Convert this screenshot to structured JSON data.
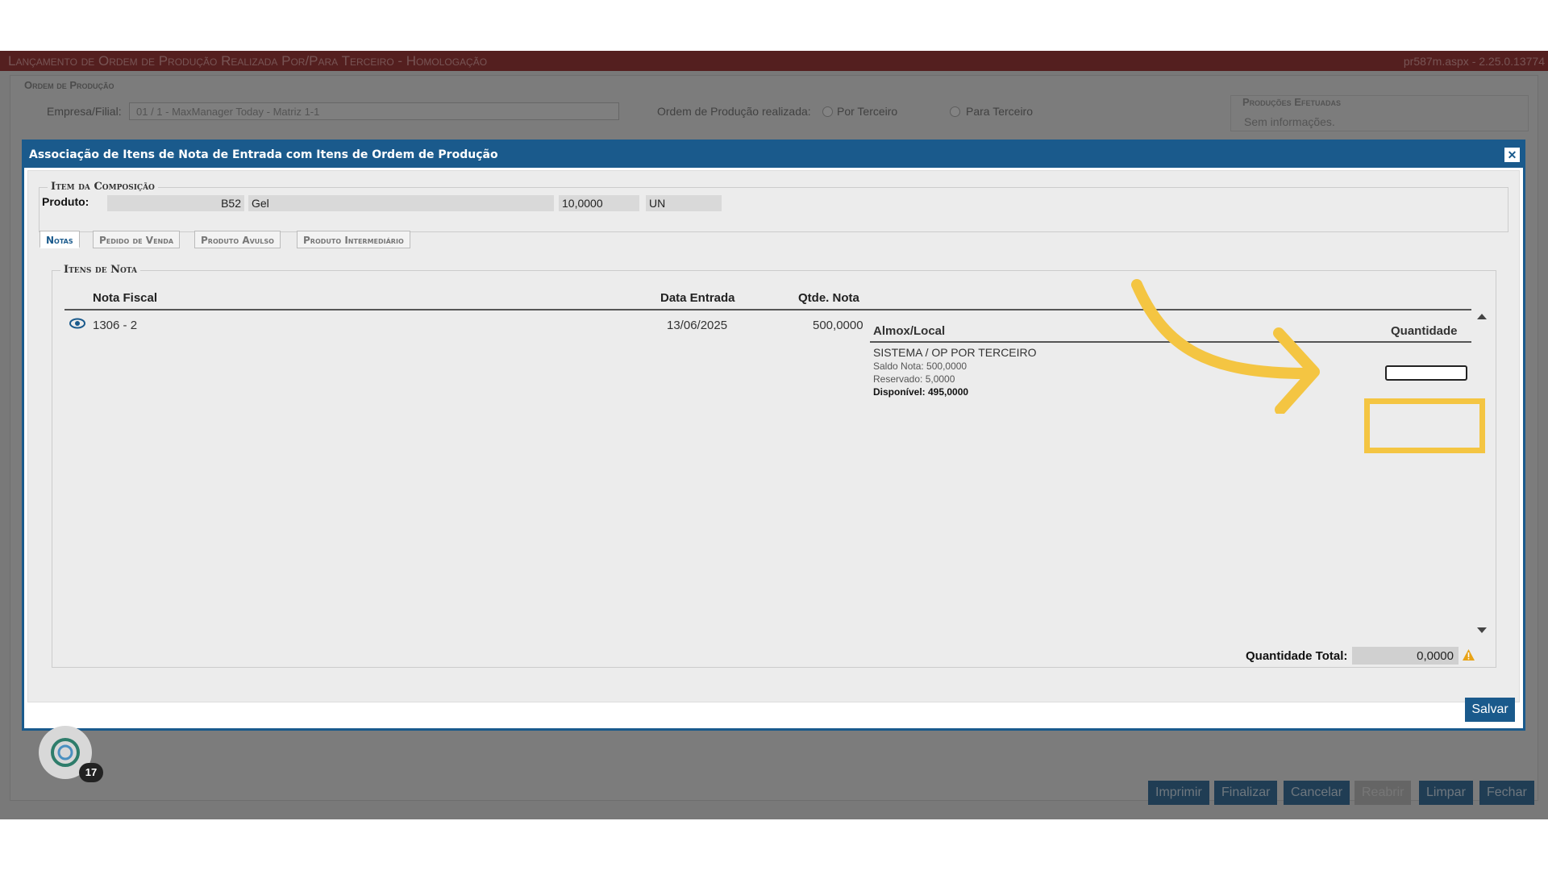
{
  "window": {
    "title": "Lançamento de Ordem de Produção Realizada Por/Para Terceiro - Homologação",
    "version": "pr587m.aspx - 2.25.0.13774"
  },
  "background_form": {
    "legend": "Ordem de Produção",
    "empresa_label": "Empresa/Filial:",
    "empresa_value": "01 / 1 - MaxManager Today - Matriz 1-1",
    "op_label": "Ordem de Produção realizada:",
    "radio_por": "Por Terceiro",
    "radio_para": "Para Terceiro",
    "panel_title": "Produções Efetuadas",
    "panel_text": "Sem informações."
  },
  "bottom_buttons": [
    "Imprimir",
    "Finalizar",
    "Cancelar",
    "Reabrir",
    "Limpar",
    "Fechar"
  ],
  "badge_count": "17",
  "dialog": {
    "title": "Associação de Itens de Nota de Entrada com Itens de Ordem de Produção",
    "close": "✕",
    "composition_legend": "Item da Composição",
    "produto_label": "Produto:",
    "produto_code": "B52",
    "produto_desc": "Gel",
    "produto_qty": "10,0000",
    "produto_unit": "UN",
    "tabs": [
      "Notas",
      "Pedido de Venda",
      "Produto Avulso",
      "Produto Intermediário"
    ],
    "items_legend": "Itens de Nota",
    "columns": {
      "nota": "Nota Fiscal",
      "data": "Data Entrada",
      "qtde": "Qtde. Nota"
    },
    "row": {
      "nota": "1306 - 2",
      "data": "13/06/2025",
      "qtde": "500,0000"
    },
    "sub_columns": {
      "almox": "Almox/Local",
      "quantidade": "Quantidade"
    },
    "sub_row": {
      "local": "SISTEMA / OP POR TERCEIRO",
      "saldo": "Saldo Nota: 500,0000",
      "reservado": "Reservado: 5,0000",
      "disponivel": "Disponível: 495,0000"
    },
    "total_label": "Quantidade Total:",
    "total_value": "0,0000",
    "save": "Salvar"
  },
  "colors": {
    "dialog_header": "#1a5a8c",
    "highlight": "#f4c542",
    "warning": "#e8a317"
  }
}
